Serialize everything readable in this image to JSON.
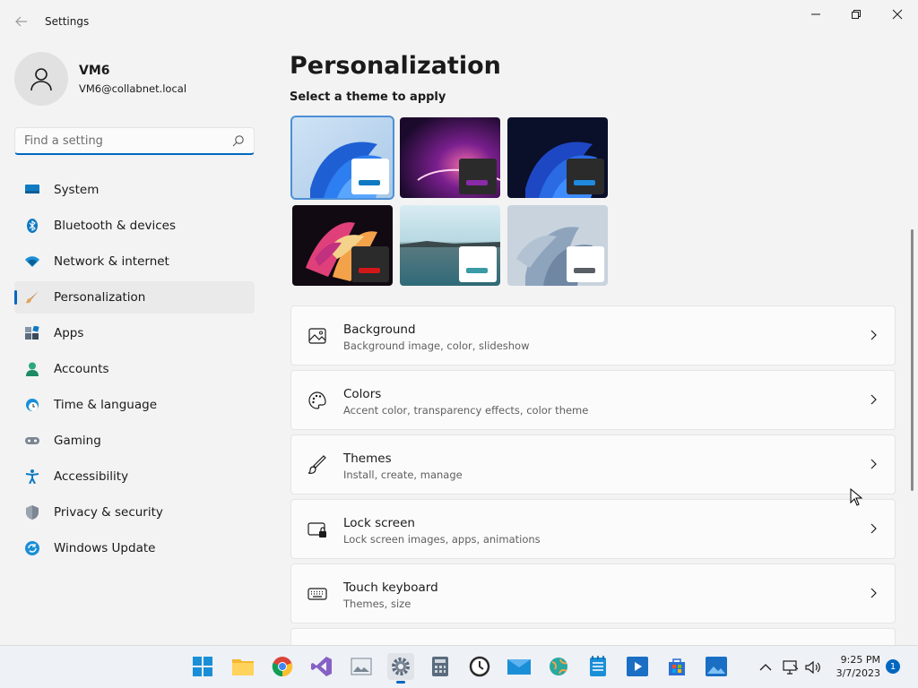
{
  "window": {
    "title": "Settings"
  },
  "user": {
    "name": "VM6",
    "email": "VM6@collabnet.local"
  },
  "search": {
    "placeholder": "Find a setting"
  },
  "sidebar": {
    "items": [
      {
        "label": "System",
        "icon": "system-icon",
        "selected": false
      },
      {
        "label": "Bluetooth & devices",
        "icon": "bluetooth-icon",
        "selected": false
      },
      {
        "label": "Network & internet",
        "icon": "wifi-icon",
        "selected": false
      },
      {
        "label": "Personalization",
        "icon": "paintbrush-icon",
        "selected": true
      },
      {
        "label": "Apps",
        "icon": "apps-icon",
        "selected": false
      },
      {
        "label": "Accounts",
        "icon": "accounts-icon",
        "selected": false
      },
      {
        "label": "Time & language",
        "icon": "globe-clock-icon",
        "selected": false
      },
      {
        "label": "Gaming",
        "icon": "gamepad-icon",
        "selected": false
      },
      {
        "label": "Accessibility",
        "icon": "accessibility-icon",
        "selected": false
      },
      {
        "label": "Privacy & security",
        "icon": "shield-icon",
        "selected": false
      },
      {
        "label": "Windows Update",
        "icon": "windows-update-icon",
        "selected": false
      }
    ]
  },
  "main": {
    "title": "Personalization",
    "theme_heading": "Select a theme to apply",
    "themes": [
      {
        "name": "windows-light-bloom",
        "selected": true
      },
      {
        "name": "glow",
        "selected": false
      },
      {
        "name": "windows-dark-bloom",
        "selected": false
      },
      {
        "name": "captured-motion",
        "selected": false
      },
      {
        "name": "sunrise",
        "selected": false
      },
      {
        "name": "flow",
        "selected": false
      }
    ],
    "cards": [
      {
        "title": "Background",
        "desc": "Background image, color, slideshow",
        "icon": "picture-icon"
      },
      {
        "title": "Colors",
        "desc": "Accent color, transparency effects, color theme",
        "icon": "palette-icon"
      },
      {
        "title": "Themes",
        "desc": "Install, create, manage",
        "icon": "brush-icon"
      },
      {
        "title": "Lock screen",
        "desc": "Lock screen images, apps, animations",
        "icon": "lock-screen-icon"
      },
      {
        "title": "Touch keyboard",
        "desc": "Themes, size",
        "icon": "keyboard-icon"
      }
    ]
  },
  "taskbar": {
    "apps": [
      "start-icon",
      "file-explorer-icon",
      "chrome-icon",
      "visual-studio-icon",
      "photos-icon",
      "settings-icon",
      "calculator-icon",
      "clock-icon",
      "mail-icon",
      "maps-icon",
      "notepad-icon",
      "media-player-icon",
      "store-icon",
      "photos-app-icon"
    ],
    "time": "9:25 PM",
    "date": "3/7/2023",
    "notification_count": "1"
  },
  "colors": {
    "accent": "#0067c0",
    "background": "#f3f3f3",
    "card": "#fbfbfb"
  }
}
